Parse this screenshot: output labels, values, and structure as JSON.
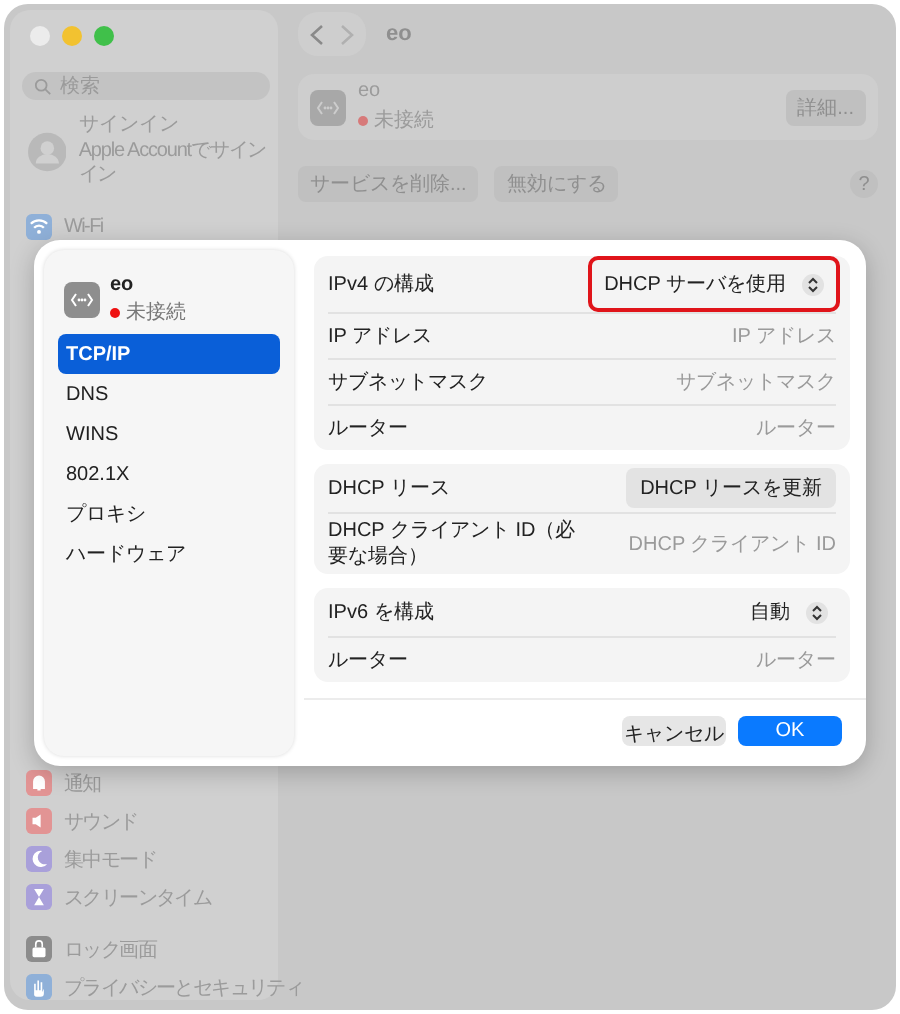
{
  "toolbar": {
    "title": "eo"
  },
  "sidebar": {
    "search": {
      "placeholder": "検索"
    },
    "account": {
      "name": "サインイン",
      "detail": "Apple Accountでサインイン"
    },
    "sections": [
      [
        {
          "label": "Wi-Fi",
          "color": "#8fb0d8"
        }
      ],
      [
        {
          "label": "通知",
          "color": "#e29494"
        },
        {
          "label": "サウンド",
          "color": "#e29494"
        },
        {
          "label": "集中モード",
          "color": "#a9a0da"
        },
        {
          "label": "スクリーンタイム",
          "color": "#a9a0da"
        }
      ],
      [
        {
          "label": "ロック画面",
          "color": "#8c8c8c"
        },
        {
          "label": "プライバシーとセキュリティ",
          "color": "#8fb0d8"
        }
      ]
    ]
  },
  "service": {
    "name": "eo",
    "status": "未接続",
    "connected": false,
    "details_button": "詳細..."
  },
  "actions": [
    "サービスを削除...",
    "無効にする"
  ],
  "help": "?",
  "sheet": {
    "service": {
      "name": "eo",
      "status": "未接続",
      "connected": false
    },
    "tabs": [
      {
        "label": "TCP/IP",
        "selected": true
      },
      {
        "label": "DNS",
        "selected": false
      },
      {
        "label": "WINS",
        "selected": false
      },
      {
        "label": "802.1X",
        "selected": false
      },
      {
        "label": "プロキシ",
        "selected": false
      },
      {
        "label": "ハードウェア",
        "selected": false
      }
    ],
    "groups": [
      {
        "rows": [
          {
            "label": "IPv4 の構成",
            "kind": "popup",
            "value": "DHCP サーバを使用",
            "highlighted": true
          },
          {
            "label": "IP アドレス",
            "kind": "field",
            "placeholder": "IP アドレス",
            "highlighted": false
          },
          {
            "label": "サブネットマスク",
            "kind": "field",
            "placeholder": "サブネットマスク",
            "highlighted": false
          },
          {
            "label": "ルーター",
            "kind": "field",
            "placeholder": "ルーター",
            "highlighted": false
          }
        ]
      },
      {
        "rows": [
          {
            "label": "DHCP リース",
            "kind": "button",
            "value": "DHCP リースを更新",
            "highlighted": false
          },
          {
            "label": "DHCP クライアント ID（必要な場合）",
            "kind": "field",
            "placeholder": "DHCP クライアント ID",
            "highlighted": false
          }
        ]
      },
      {
        "rows": [
          {
            "label": "IPv6 を構成",
            "kind": "popup",
            "value": "自動",
            "highlighted": false
          },
          {
            "label": "ルーター",
            "kind": "field",
            "placeholder": "ルーター",
            "highlighted": false
          }
        ]
      }
    ],
    "buttons": [
      {
        "label": "キャンセル",
        "kind": "cancel"
      },
      {
        "label": "OK",
        "kind": "default"
      }
    ]
  }
}
